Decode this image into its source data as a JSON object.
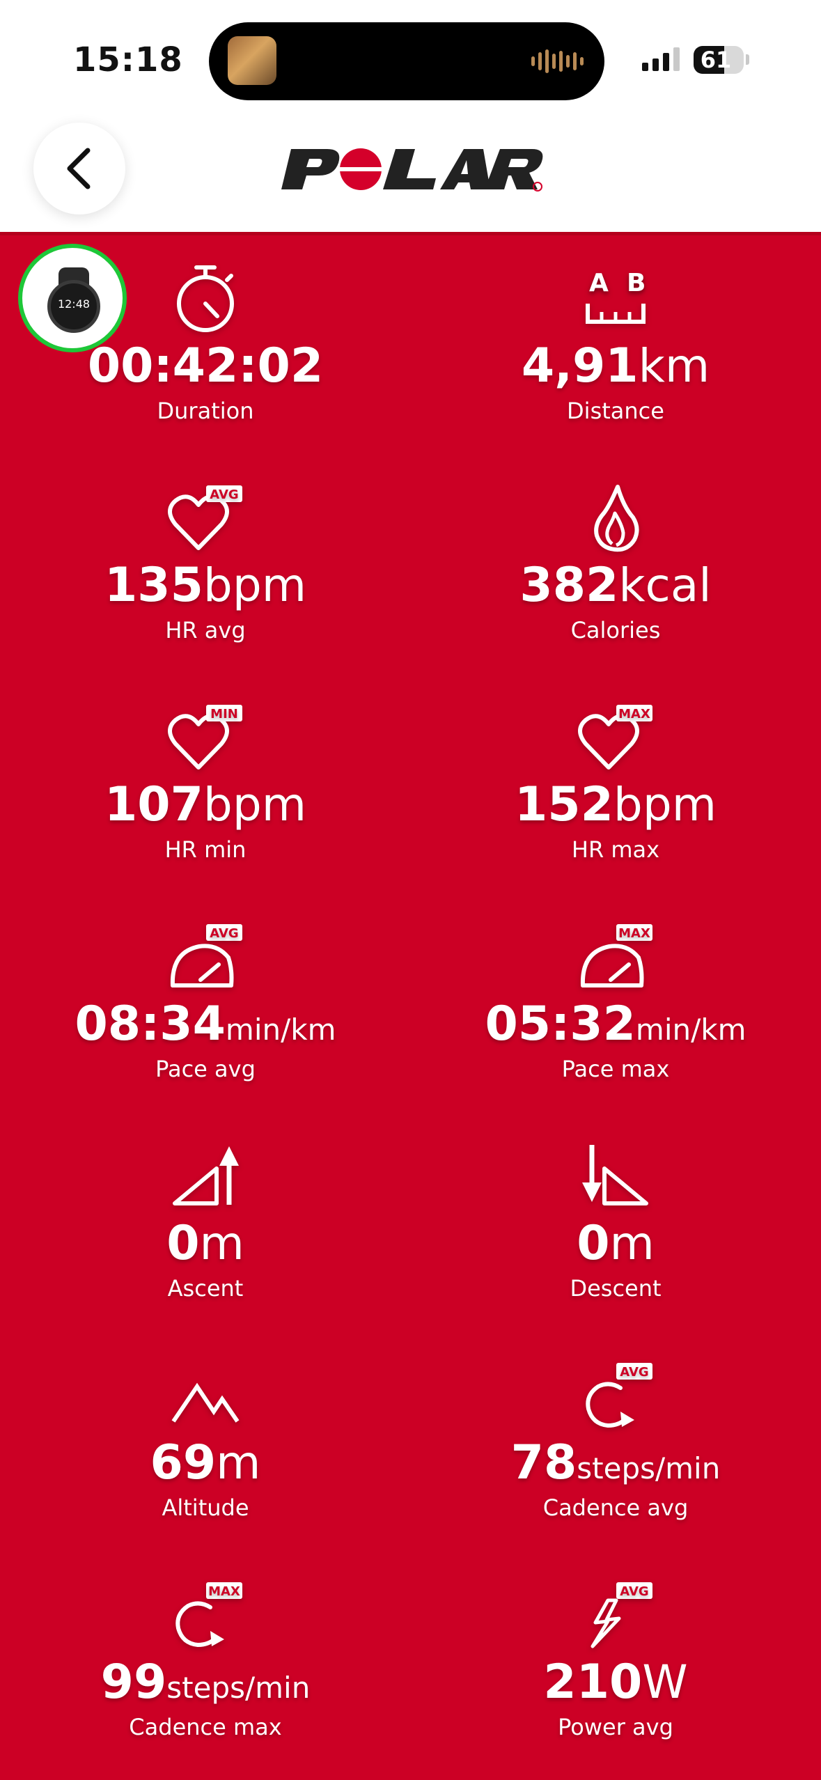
{
  "status_bar": {
    "time": "15:18",
    "battery": "61",
    "battery_level": 0.61
  },
  "header": {
    "logo_text": "POLAR"
  },
  "device": {
    "watch_time": "12:48"
  },
  "metrics": [
    {
      "value": "00:42:02",
      "unit": "",
      "label": "Duration",
      "icon": "stopwatch-icon"
    },
    {
      "value": "4,91",
      "unit": "km",
      "label": "Distance",
      "icon": "distance-ab-icon",
      "icon_text_a": "A",
      "icon_text_b": "B"
    },
    {
      "value": "135",
      "unit": "bpm",
      "label": "HR avg",
      "icon": "heart-avg-icon",
      "badge": "AVG"
    },
    {
      "value": "382",
      "unit": "kcal",
      "label": "Calories",
      "icon": "flame-icon"
    },
    {
      "value": "107",
      "unit": "bpm",
      "label": "HR min",
      "icon": "heart-min-icon",
      "badge": "MIN"
    },
    {
      "value": "152",
      "unit": "bpm",
      "label": "HR max",
      "icon": "heart-max-icon",
      "badge": "MAX"
    },
    {
      "value": "08:34",
      "unit": "min/km",
      "label": "Pace avg",
      "icon": "speedometer-avg-icon",
      "badge": "AVG"
    },
    {
      "value": "05:32",
      "unit": "min/km",
      "label": "Pace max",
      "icon": "speedometer-max-icon",
      "badge": "MAX"
    },
    {
      "value": "0",
      "unit": "m",
      "label": "Ascent",
      "icon": "ascent-icon"
    },
    {
      "value": "0",
      "unit": "m",
      "label": "Descent",
      "icon": "descent-icon"
    },
    {
      "value": "69",
      "unit": "m",
      "label": "Altitude",
      "icon": "mountain-icon"
    },
    {
      "value": "78",
      "unit": "steps/min",
      "label": "Cadence avg",
      "icon": "cadence-avg-icon",
      "badge": "AVG"
    },
    {
      "value": "99",
      "unit": "steps/min",
      "label": "Cadence max",
      "icon": "cadence-max-icon",
      "badge": "MAX"
    },
    {
      "value": "210",
      "unit": "W",
      "label": "Power avg",
      "icon": "power-avg-icon",
      "badge": "AVG"
    }
  ],
  "colors": {
    "brand_red": "#cc0025",
    "device_ring": "#1ec738"
  }
}
